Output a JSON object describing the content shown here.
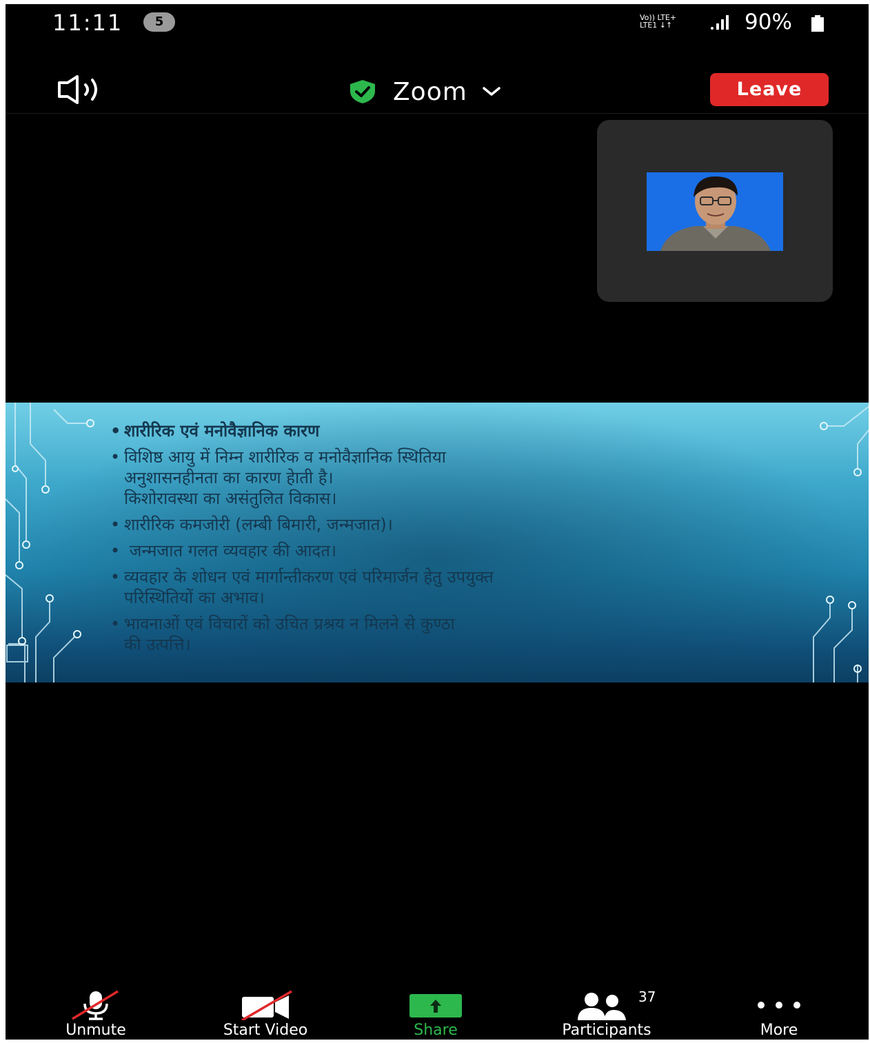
{
  "status_bar": {
    "time": "11:11",
    "notification_count": "5",
    "network_label_top": "Vo)) LTE+",
    "network_label_bottom": "LTE1 ↓↑",
    "battery": "90%"
  },
  "header": {
    "title": "Zoom",
    "leave_label": "Leave",
    "shield_color": "#2db84d",
    "leave_color": "#e02828"
  },
  "shared_slide": {
    "items": [
      {
        "text": "शारीरिक एवं मनोवैज्ञानिक कारण"
      },
      {
        "text": "विशिष्ठ आयु में निम्न शारीरिक व मनोवैज्ञानिक स्थितिया"
      },
      {
        "text": "अनुशासनहीनता का कारण हेाती है।"
      },
      {
        "text": "किशोरावस्था का असंतुलित विकास।"
      },
      {
        "text": "शारीरिक कमजोरी (लम्बी बिमारी, जन्मजात)।"
      },
      {
        "text": " जन्मजात गलत व्यवहार की आदत।"
      },
      {
        "text": "व्यवहार के शोधन एवं मार्गान्तीकरण एवं परिमार्जन हेतु उपयुक्त"
      },
      {
        "text": "परिस्थितियों का अभाव।"
      },
      {
        "text": "भावनाओं एवं विचारों को उचित प्रश्रय न मिलने से कुण्ठा"
      },
      {
        "text": "की उत्पत्ति।"
      }
    ]
  },
  "toolbar": {
    "unmute_label": "Unmute",
    "start_video_label": "Start Video",
    "share_label": "Share",
    "participants_label": "Participants",
    "participants_count": "37",
    "more_label": "More",
    "share_color": "#2db84d",
    "muted_slash_color": "#e0282a"
  }
}
